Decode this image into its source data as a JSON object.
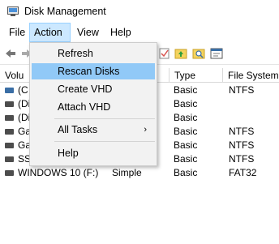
{
  "window": {
    "title": "Disk Management",
    "icon": "disk-management-icon"
  },
  "menubar": {
    "items": [
      {
        "label": "File"
      },
      {
        "label": "Action",
        "active": true
      },
      {
        "label": "View"
      },
      {
        "label": "Help"
      }
    ]
  },
  "toolbar": {
    "buttons": [
      {
        "icon": "back-arrow-icon"
      },
      {
        "icon": "forward-arrow-icon"
      },
      {
        "icon": "properties-icon"
      },
      {
        "icon": "up-folder-icon"
      },
      {
        "icon": "search-icon"
      },
      {
        "icon": "console-icon"
      }
    ]
  },
  "table": {
    "columns": [
      "Volu",
      "Type",
      "File System"
    ],
    "rows": [
      {
        "volume": "(C",
        "layout": "",
        "type": "Basic",
        "fs": "NTFS",
        "icon": "os-volume-icon"
      },
      {
        "volume": "(Di",
        "layout": "",
        "type": "Basic",
        "fs": "",
        "icon": "volume-icon"
      },
      {
        "volume": "(Di",
        "layout": "",
        "type": "Basic",
        "fs": "",
        "icon": "volume-icon"
      },
      {
        "volume": "Ga",
        "layout": "",
        "type": "Basic",
        "fs": "NTFS",
        "icon": "volume-icon"
      },
      {
        "volume": "Ga",
        "layout": "",
        "type": "Basic",
        "fs": "NTFS",
        "icon": "volume-icon"
      },
      {
        "volume": "SSI",
        "layout": "",
        "type": "Basic",
        "fs": "NTFS",
        "icon": "volume-icon"
      },
      {
        "volume": "WINDOWS 10 (F:)",
        "layout": "Simple",
        "type": "Basic",
        "fs": "FAT32",
        "icon": "volume-icon"
      }
    ]
  },
  "action_menu": {
    "items": [
      {
        "label": "Refresh"
      },
      {
        "label": "Rescan Disks",
        "highlighted": true
      },
      {
        "label": "Create VHD"
      },
      {
        "label": "Attach VHD"
      },
      {
        "label": "All Tasks",
        "submenu": true,
        "arrow": "›"
      },
      {
        "label": "Help"
      }
    ]
  },
  "colors": {
    "menu_active_bg": "#cce8ff",
    "menu_highlight_bg": "#91c9f7",
    "dropdown_bg": "#f2f2f2"
  }
}
